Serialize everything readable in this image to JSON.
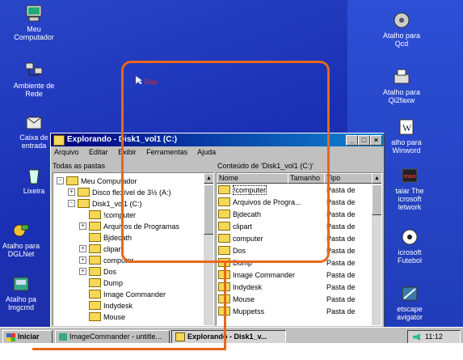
{
  "desktop_icons_left": [
    {
      "label": "Meu\nComputador",
      "icon": "my-computer-icon"
    },
    {
      "label": "Ambiente de\nRede",
      "icon": "network-icon"
    },
    {
      "label": "Caixa de\nentrada",
      "icon": "inbox-icon"
    },
    {
      "label": "Lixeira",
      "icon": "recycle-bin-icon"
    },
    {
      "label": "Atalho para\nDGLNet",
      "icon": "dglnet-icon"
    },
    {
      "label": "Atalho pa\nImgcmd",
      "icon": "imgcmd-icon"
    }
  ],
  "desktop_icons_right": [
    {
      "label": "Atalho para\nQcd",
      "icon": "qcd-icon"
    },
    {
      "label": "Atalho para\nQi2faxw",
      "icon": "fax-icon"
    },
    {
      "label": "alho para\nWinword",
      "icon": "winword-icon"
    },
    {
      "label": "talar The\nicrosoft\nletwork",
      "icon": "msn-icon"
    },
    {
      "label": "icrosoft\nFutebol",
      "icon": "soccer-icon"
    },
    {
      "label": "etscape\navigator",
      "icon": "netscape-icon"
    }
  ],
  "drag_label": "Disp",
  "explorer": {
    "title": "Explorando - Disk1_vol1 (C:)",
    "menu": [
      "Arquivo",
      "Editar",
      "Exibir",
      "Ferramentas",
      "Ajuda"
    ],
    "left_header": "Todas as pastas",
    "right_header": "Conteúdo de 'Disk1_vol1 (C:)'",
    "tree": [
      {
        "label": "Meu Computador",
        "indent": 0,
        "expander": "-"
      },
      {
        "label": "Disco flexível de 3½ (A:)",
        "indent": 1,
        "expander": "+"
      },
      {
        "label": "Disk1_vol1 (C:)",
        "indent": 1,
        "expander": "-"
      },
      {
        "label": "!computer",
        "indent": 2,
        "expander": ""
      },
      {
        "label": "Arquivos de Programas",
        "indent": 2,
        "expander": "+"
      },
      {
        "label": "Bjdecath",
        "indent": 2,
        "expander": ""
      },
      {
        "label": "clipart",
        "indent": 2,
        "expander": "+"
      },
      {
        "label": "computer",
        "indent": 2,
        "expander": "+"
      },
      {
        "label": "Dos",
        "indent": 2,
        "expander": "+"
      },
      {
        "label": "Dump",
        "indent": 2,
        "expander": ""
      },
      {
        "label": "Image Commander",
        "indent": 2,
        "expander": ""
      },
      {
        "label": "Indydesk",
        "indent": 2,
        "expander": ""
      },
      {
        "label": "Mouse",
        "indent": 2,
        "expander": ""
      }
    ],
    "columns": [
      "Nome",
      "Tamanho",
      "Tipo"
    ],
    "files": [
      {
        "name": "!computer",
        "type": "Pasta de"
      },
      {
        "name": "Arquivos de Progra...",
        "type": "Pasta de"
      },
      {
        "name": "Bjdecath",
        "type": "Pasta de"
      },
      {
        "name": "clipart",
        "type": "Pasta de"
      },
      {
        "name": "computer",
        "type": "Pasta de"
      },
      {
        "name": "Dos",
        "type": "Pasta de"
      },
      {
        "name": "Dump",
        "type": "Pasta de"
      },
      {
        "name": "Image Commander",
        "type": "Pasta de"
      },
      {
        "name": "Indydesk",
        "type": "Pasta de"
      },
      {
        "name": "Mouse",
        "type": "Pasta de"
      },
      {
        "name": "Muppetss",
        "type": "Pasta de"
      }
    ]
  },
  "taskbar": {
    "start": "Iniciar",
    "tasks": [
      "ImageCommander - untitle...",
      "Explorando - Disk1_v..."
    ],
    "clock": "11:12"
  },
  "colors": {
    "accent_orange": "#e8671a",
    "titlebar": "#000080",
    "desktop": "#1f35b5"
  }
}
